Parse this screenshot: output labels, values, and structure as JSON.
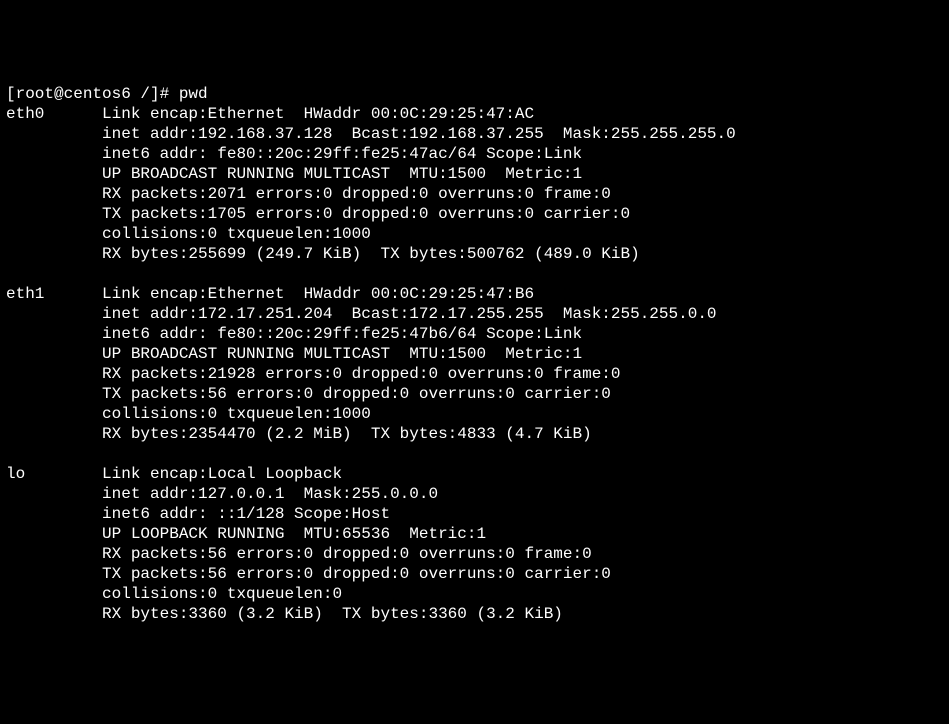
{
  "prompt": {
    "text": "[root@centos6 /]# pwd"
  },
  "interfaces": [
    {
      "name": "eth0",
      "lines": [
        "Link encap:Ethernet  HWaddr 00:0C:29:25:47:AC",
        "inet addr:192.168.37.128  Bcast:192.168.37.255  Mask:255.255.255.0",
        "inet6 addr: fe80::20c:29ff:fe25:47ac/64 Scope:Link",
        "UP BROADCAST RUNNING MULTICAST  MTU:1500  Metric:1",
        "RX packets:2071 errors:0 dropped:0 overruns:0 frame:0",
        "TX packets:1705 errors:0 dropped:0 overruns:0 carrier:0",
        "collisions:0 txqueuelen:1000",
        "RX bytes:255699 (249.7 KiB)  TX bytes:500762 (489.0 KiB)"
      ]
    },
    {
      "name": "eth1",
      "lines": [
        "Link encap:Ethernet  HWaddr 00:0C:29:25:47:B6",
        "inet addr:172.17.251.204  Bcast:172.17.255.255  Mask:255.255.0.0",
        "inet6 addr: fe80::20c:29ff:fe25:47b6/64 Scope:Link",
        "UP BROADCAST RUNNING MULTICAST  MTU:1500  Metric:1",
        "RX packets:21928 errors:0 dropped:0 overruns:0 frame:0",
        "TX packets:56 errors:0 dropped:0 overruns:0 carrier:0",
        "collisions:0 txqueuelen:1000",
        "RX bytes:2354470 (2.2 MiB)  TX bytes:4833 (4.7 KiB)"
      ]
    },
    {
      "name": "lo",
      "lines": [
        "Link encap:Local Loopback",
        "inet addr:127.0.0.1  Mask:255.0.0.0",
        "inet6 addr: ::1/128 Scope:Host",
        "UP LOOPBACK RUNNING  MTU:65536  Metric:1",
        "RX packets:56 errors:0 dropped:0 overruns:0 frame:0",
        "TX packets:56 errors:0 dropped:0 overruns:0 carrier:0",
        "collisions:0 txqueuelen:0",
        "RX bytes:3360 (3.2 KiB)  TX bytes:3360 (3.2 KiB)"
      ]
    }
  ]
}
